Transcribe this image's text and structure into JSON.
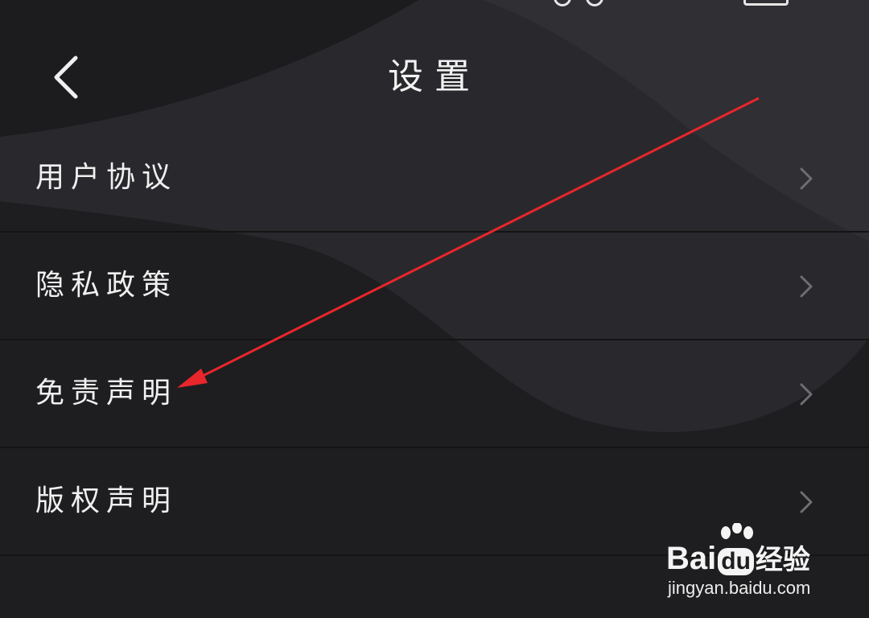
{
  "header": {
    "title": "设置"
  },
  "menu": {
    "items": [
      {
        "label": "用户协议"
      },
      {
        "label": "隐私政策"
      },
      {
        "label": "免责声明"
      },
      {
        "label": "版权声明"
      }
    ]
  },
  "watermark": {
    "logo_text_left": "Bai",
    "logo_text_du": "du",
    "logo_text_right": "经验",
    "url": "jingyan.baidu.com"
  },
  "colors": {
    "background": "#1e1e20",
    "background_shape": "#2a2a2e",
    "text": "#f0f0f0",
    "chevron": "#6e6e72",
    "divider": "#141415",
    "annotation_arrow": "#e8262b"
  },
  "icons": {
    "back": "chevron-left-icon",
    "item_chevron": "chevron-right-icon"
  }
}
